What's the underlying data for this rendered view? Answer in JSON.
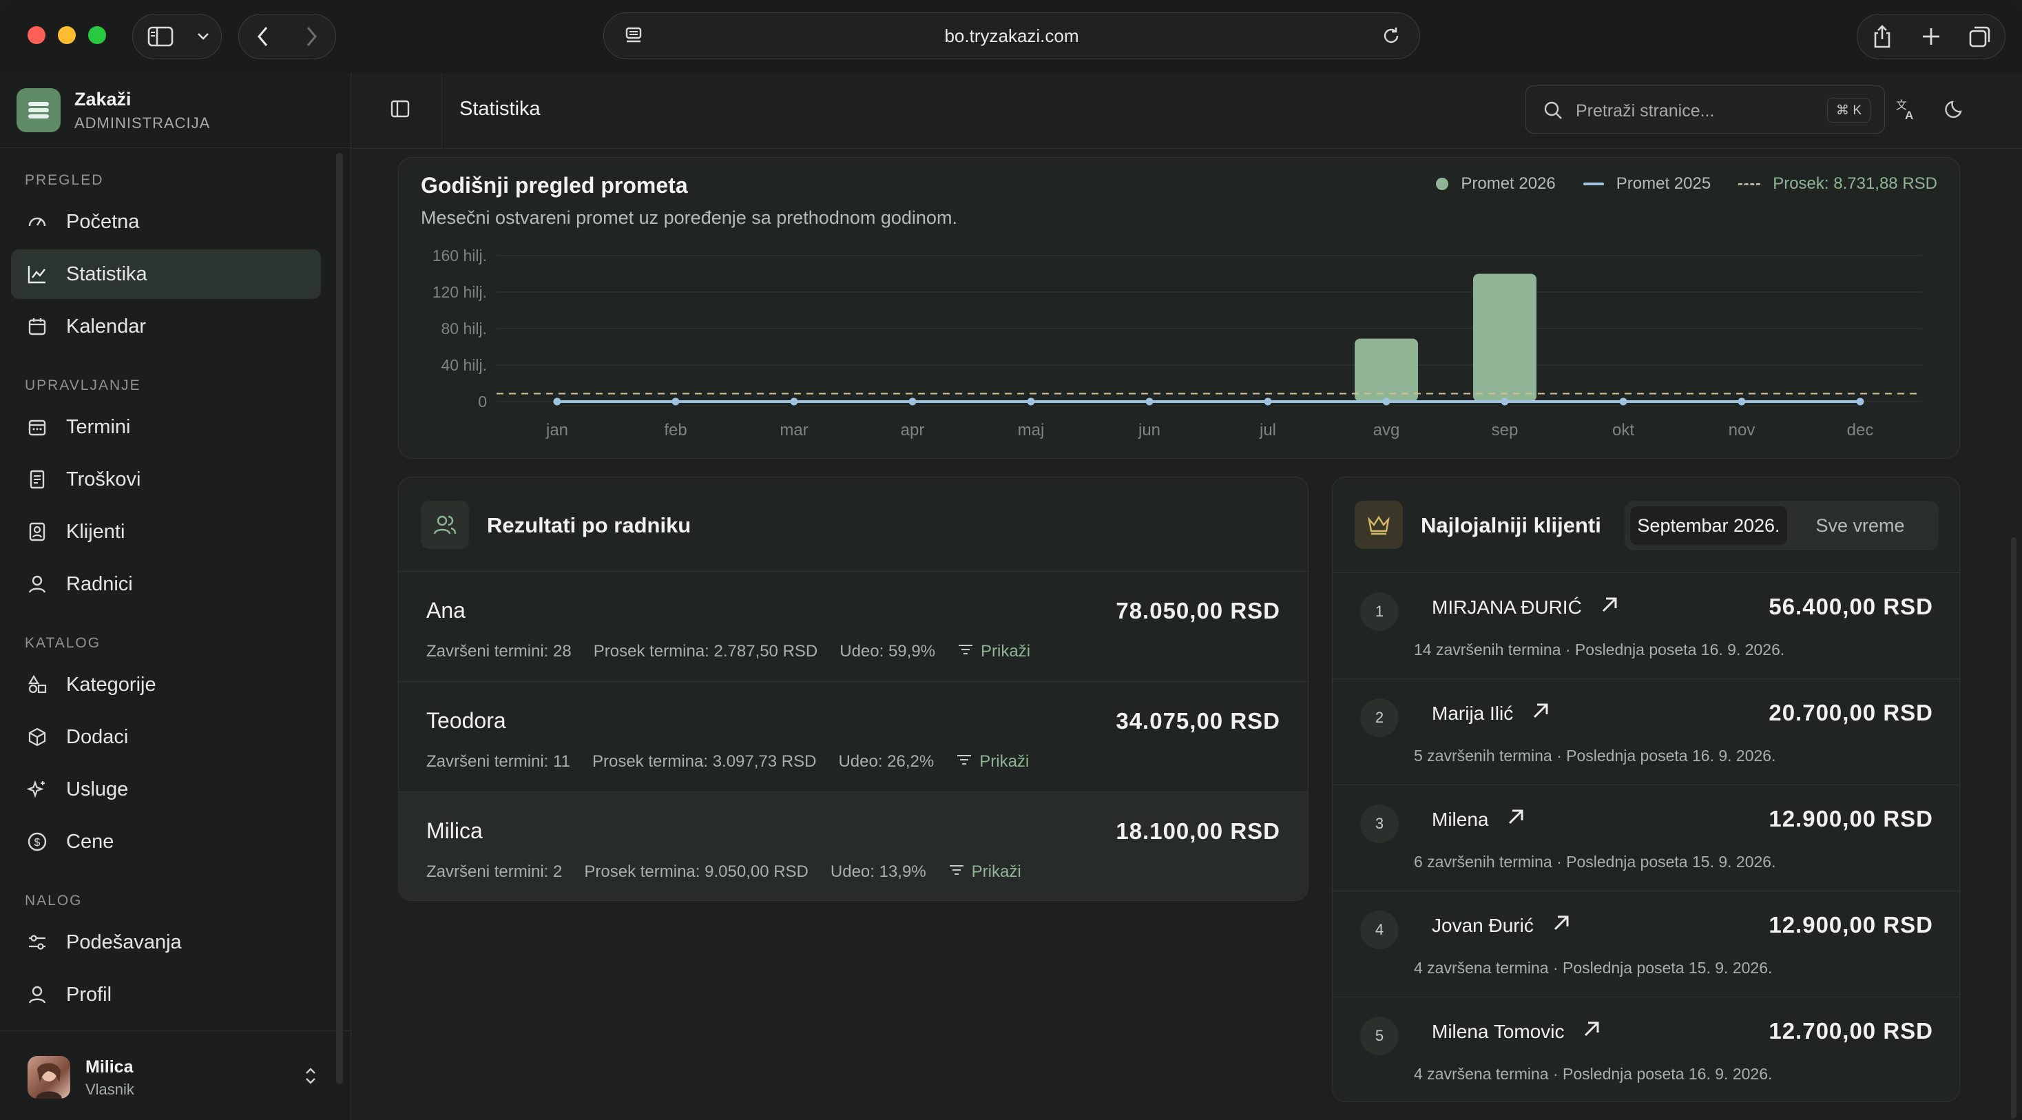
{
  "browser": {
    "url": "bo.tryzakazi.com"
  },
  "brand": {
    "name": "Zakaži",
    "subtitle": "ADMINISTRACIJA"
  },
  "sidebar": {
    "sections": {
      "pregled": "PREGLED",
      "upravljanje": "UPRAVLJANJE",
      "katalog": "KATALOG",
      "nalog": "NALOG"
    },
    "items": {
      "pocetna": "Početna",
      "statistika": "Statistika",
      "kalendar": "Kalendar",
      "termini": "Termini",
      "troskovi": "Troškovi",
      "klijenti": "Klijenti",
      "radnici": "Radnici",
      "kategorije": "Kategorije",
      "dodaci": "Dodaci",
      "usluge": "Usluge",
      "cene": "Cene",
      "podesavanja": "Podešavanja",
      "profil": "Profil"
    },
    "active": "statistika"
  },
  "user": {
    "name": "Milica",
    "role": "Vlasnik"
  },
  "header": {
    "title": "Statistika",
    "search_placeholder": "Pretraži stranice...",
    "shortcut": "⌘ K"
  },
  "revenue": {
    "title": "Godišnji pregled prometa",
    "subtitle": "Mesečni ostvareni promet uz poređenje sa prethodnom godinom.",
    "legend": {
      "current": "Promet 2026",
      "previous": "Promet 2025",
      "average": "Prosek: 8.731,88 RSD"
    }
  },
  "chart_data": {
    "type": "bar",
    "title": "Godišnji pregled prometa",
    "categories": [
      "jan",
      "feb",
      "mar",
      "apr",
      "maj",
      "jun",
      "jul",
      "avg",
      "sep",
      "okt",
      "nov",
      "dec"
    ],
    "y_ticks": [
      "0",
      "40 hilj.",
      "80 hilj.",
      "120 hilj.",
      "160 hilj."
    ],
    "ylim": [
      0,
      160000
    ],
    "series": [
      {
        "name": "Promet 2026",
        "type": "bar",
        "color": "#8fb596",
        "values": [
          0,
          0,
          0,
          0,
          0,
          0,
          0,
          69000,
          140000,
          0,
          0,
          0
        ]
      },
      {
        "name": "Promet 2025",
        "type": "line",
        "color": "#9ec3e0",
        "values": [
          0,
          0,
          0,
          0,
          0,
          0,
          0,
          0,
          0,
          0,
          0,
          0
        ]
      }
    ],
    "average": {
      "label": "Prosek: 8.731,88 RSD",
      "value": 8731.88,
      "color": "#cdbf8f"
    },
    "grid": true,
    "legend_position": "top-right"
  },
  "workers": {
    "title": "Rezultati po radniku",
    "show_label": "Prikaži",
    "rows": [
      {
        "name": "Ana",
        "amount": "78.050,00 RSD",
        "done": "Završeni termini: 28",
        "avg": "Prosek termina: 2.787,50 RSD",
        "share": "Udeo: 59,9%"
      },
      {
        "name": "Teodora",
        "amount": "34.075,00 RSD",
        "done": "Završeni termini: 11",
        "avg": "Prosek termina: 3.097,73 RSD",
        "share": "Udeo: 26,2%"
      },
      {
        "name": "Milica",
        "amount": "18.100,00 RSD",
        "done": "Završeni termini: 2",
        "avg": "Prosek termina: 9.050,00 RSD",
        "share": "Udeo: 13,9%"
      }
    ]
  },
  "clients": {
    "title": "Najlojalniji klijenti",
    "tabs": {
      "active": "Septembar 2026.",
      "other": "Sve vreme"
    },
    "rows": [
      {
        "rank": "1",
        "name": "MIRJANA ĐURIĆ",
        "amount": "56.400,00 RSD",
        "meta": "14 završenih termina · Poslednja poseta 16. 9. 2026."
      },
      {
        "rank": "2",
        "name": "Marija Ilić",
        "amount": "20.700,00 RSD",
        "meta": "5 završenih termina · Poslednja poseta 16. 9. 2026."
      },
      {
        "rank": "3",
        "name": "Milena",
        "amount": "12.900,00 RSD",
        "meta": "6 završenih termina · Poslednja poseta 15. 9. 2026."
      },
      {
        "rank": "4",
        "name": "Jovan Đurić",
        "amount": "12.900,00 RSD",
        "meta": "4 završena termina · Poslednja poseta 15. 9. 2026."
      },
      {
        "rank": "5",
        "name": "Milena Tomovic",
        "amount": "12.700,00 RSD",
        "meta": "4 završena termina · Poslednja poseta 16. 9. 2026."
      }
    ]
  }
}
